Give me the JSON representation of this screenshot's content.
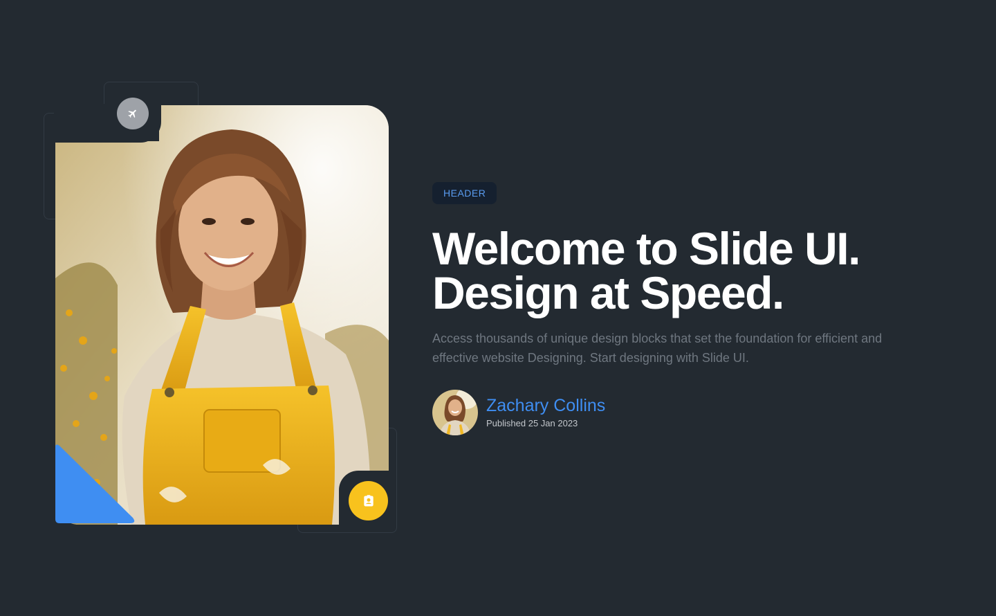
{
  "hero": {
    "badge": "HEADER",
    "headline_line1": "Welcome to Slide UI.",
    "headline_line2": "Design at Speed.",
    "description": "Access thousands of unique design blocks that set the foundation for efficient and effective website Designing. Start designing with Slide UI."
  },
  "author": {
    "name": "Zachary Collins",
    "published": "Published 25 Jan 2023"
  },
  "icons": {
    "top_badge": "airplane-icon",
    "bottom_badge": "contact-card-icon",
    "corner_shape": "blue-triangle"
  },
  "colors": {
    "background": "#232a31",
    "accent_blue": "#3f8ef2",
    "accent_yellow": "#f8c21d",
    "badge_background": "#15202f",
    "muted_text": "#6f7780"
  }
}
